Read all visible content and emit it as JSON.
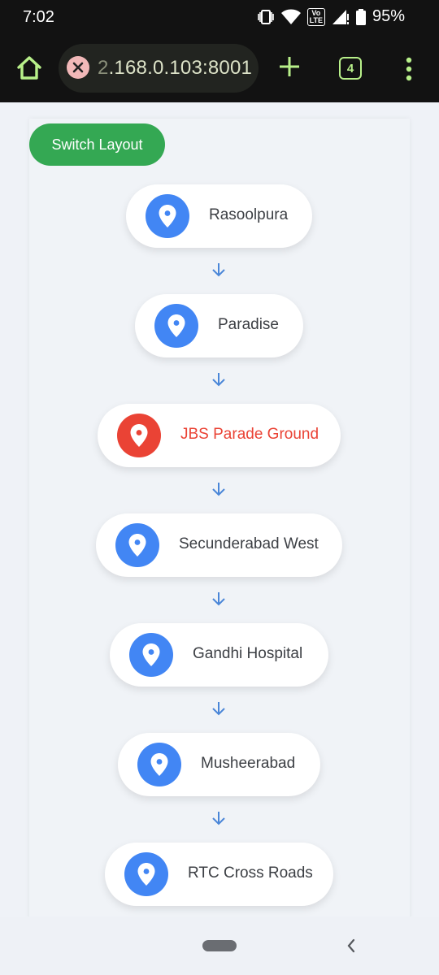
{
  "status_bar": {
    "time": "7:02",
    "lte_label_top": "Vo",
    "lte_label_bottom": "LTE",
    "battery": "95%"
  },
  "browser": {
    "url_faded": "2",
    "url_main": ".168.0.103:8001",
    "tab_count": "4"
  },
  "page": {
    "switch_button_label": "Switch Layout",
    "stops": [
      {
        "name": "Rasoolpura",
        "active": false
      },
      {
        "name": "Paradise",
        "active": false
      },
      {
        "name": "JBS Parade Ground",
        "active": true
      },
      {
        "name": "Secunderabad West",
        "active": false
      },
      {
        "name": "Gandhi Hospital",
        "active": false
      },
      {
        "name": "Musheerabad",
        "active": false
      },
      {
        "name": "RTC Cross Roads",
        "active": false
      }
    ]
  },
  "colors": {
    "pin_default": "#4286f4",
    "pin_active": "#ea4335",
    "switch_button": "#34a853",
    "arrow": "#4a86d8",
    "toolbar_accent": "#b8f08a"
  },
  "icons": {
    "home": "home-icon",
    "page_error": "close-icon",
    "new_tab": "plus-icon",
    "menu": "more-vert-icon",
    "stop_marker": "location-pin-icon",
    "connector": "arrow-down-icon"
  }
}
